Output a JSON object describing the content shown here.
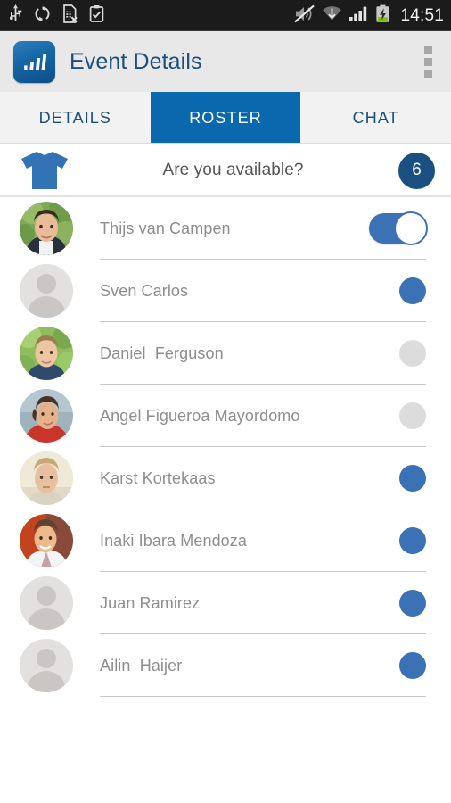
{
  "statusbar": {
    "time": "14:51",
    "left_icons": [
      "usb-icon",
      "sync-icon",
      "sim-card-removed-icon",
      "clipboard-check-icon"
    ],
    "right_icons": [
      "volume-mute-icon",
      "wifi-icon",
      "cellular-signal-icon",
      "battery-charging-icon"
    ]
  },
  "actionbar": {
    "logo_icon": "bar-chart-app-logo",
    "title": "Event Details",
    "overflow_icon": "overflow-menu-icon"
  },
  "tabs": [
    {
      "label": "DETAILS",
      "selected": false
    },
    {
      "label": "ROSTER",
      "selected": true
    },
    {
      "label": "CHAT",
      "selected": false
    }
  ],
  "availability": {
    "icon": "jersey-tshirt-icon",
    "question": "Are you available?",
    "count": "6"
  },
  "colors": {
    "accent_blue": "#0a69ae",
    "toggle_blue": "#3b72b5",
    "badge_navy": "#1a4f82",
    "inactive_gray": "#dcdcdc",
    "title_blue": "#1a4f7d",
    "name_gray": "#8e8e8e"
  },
  "roster": [
    {
      "name": "Thijs van Campen",
      "avatar": "photo-avatar-thijs",
      "control": "toggle-on"
    },
    {
      "name": "Sven Carlos",
      "avatar": "placeholder-avatar",
      "control": "dot-on"
    },
    {
      "name": "Daniel  Ferguson",
      "avatar": "photo-avatar-daniel",
      "control": "dot-off"
    },
    {
      "name": "Angel Figueroa Mayordomo",
      "avatar": "photo-avatar-angel",
      "control": "dot-off"
    },
    {
      "name": "Karst Kortekaas",
      "avatar": "photo-avatar-karst",
      "control": "dot-on"
    },
    {
      "name": "Inaki Ibara Mendoza",
      "avatar": "photo-avatar-inaki",
      "control": "dot-on"
    },
    {
      "name": "Juan Ramirez",
      "avatar": "placeholder-avatar",
      "control": "dot-on"
    },
    {
      "name": "Ailin  Haijer",
      "avatar": "placeholder-avatar",
      "control": "dot-on"
    }
  ]
}
